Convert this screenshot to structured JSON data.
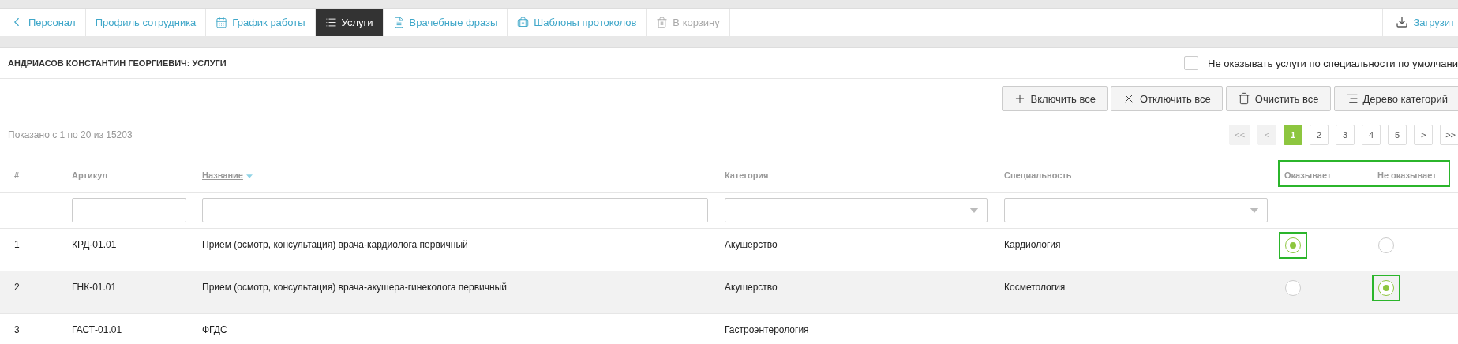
{
  "nav": {
    "tabs": [
      {
        "label": "Персонал",
        "selected": false,
        "disabled": false
      },
      {
        "label": "Профиль сотрудника",
        "selected": false,
        "disabled": false
      },
      {
        "label": "График работы",
        "selected": false,
        "disabled": false
      },
      {
        "label": "Услуги",
        "selected": true,
        "disabled": false
      },
      {
        "label": "Врачебные фразы",
        "selected": false,
        "disabled": false
      },
      {
        "label": "Шаблоны протоколов",
        "selected": false,
        "disabled": false
      },
      {
        "label": "В корзину",
        "selected": false,
        "disabled": true
      }
    ],
    "download": "Загрузит"
  },
  "page_title": "АНДРИАСОВ КОНСТАНТИН ГЕОРГИЕВИЧ: УСЛУГИ",
  "default_option": {
    "label": "Не оказывать услуги по специальности по умолчани",
    "checked": false
  },
  "toolbar": [
    "Включить все",
    "Отключить все",
    "Очистить все",
    "Дерево категорий"
  ],
  "summary": "Показано с 1 по 20 из 15203",
  "pagination": [
    {
      "label": "<<",
      "selected": false,
      "disabled": true
    },
    {
      "label": "<",
      "selected": false,
      "disabled": true
    },
    {
      "label": "1",
      "selected": true,
      "disabled": false
    },
    {
      "label": "2",
      "selected": false,
      "disabled": false
    },
    {
      "label": "3",
      "selected": false,
      "disabled": false
    },
    {
      "label": "4",
      "selected": false,
      "disabled": false
    },
    {
      "label": "5",
      "selected": false,
      "disabled": false
    },
    {
      "label": ">",
      "selected": false,
      "disabled": false
    },
    {
      "label": ">>",
      "selected": false,
      "disabled": false
    }
  ],
  "table": {
    "columns": [
      "#",
      "Артикул",
      "Название",
      "Категория",
      "Специальность",
      "Оказывает",
      "Не оказывает"
    ],
    "rows": [
      {
        "num": "1",
        "code": "КРД-01.01",
        "name": "Прием (осмотр, консультация) врача-кардиолога первичный",
        "category": "Акушерство",
        "specialty": "Кардиология",
        "provides": true
      },
      {
        "num": "2",
        "code": "ГНК-01.01",
        "name": "Прием (осмотр, консультация) врача-акушера-гинеколога первичный",
        "category": "Акушерство",
        "specialty": "Косметология",
        "provides": false
      },
      {
        "num": "3",
        "code": "ГАСТ-01.01",
        "name": "ФГДС",
        "category": "Гастроэнтерология",
        "specialty": "",
        "provides": null
      }
    ]
  }
}
